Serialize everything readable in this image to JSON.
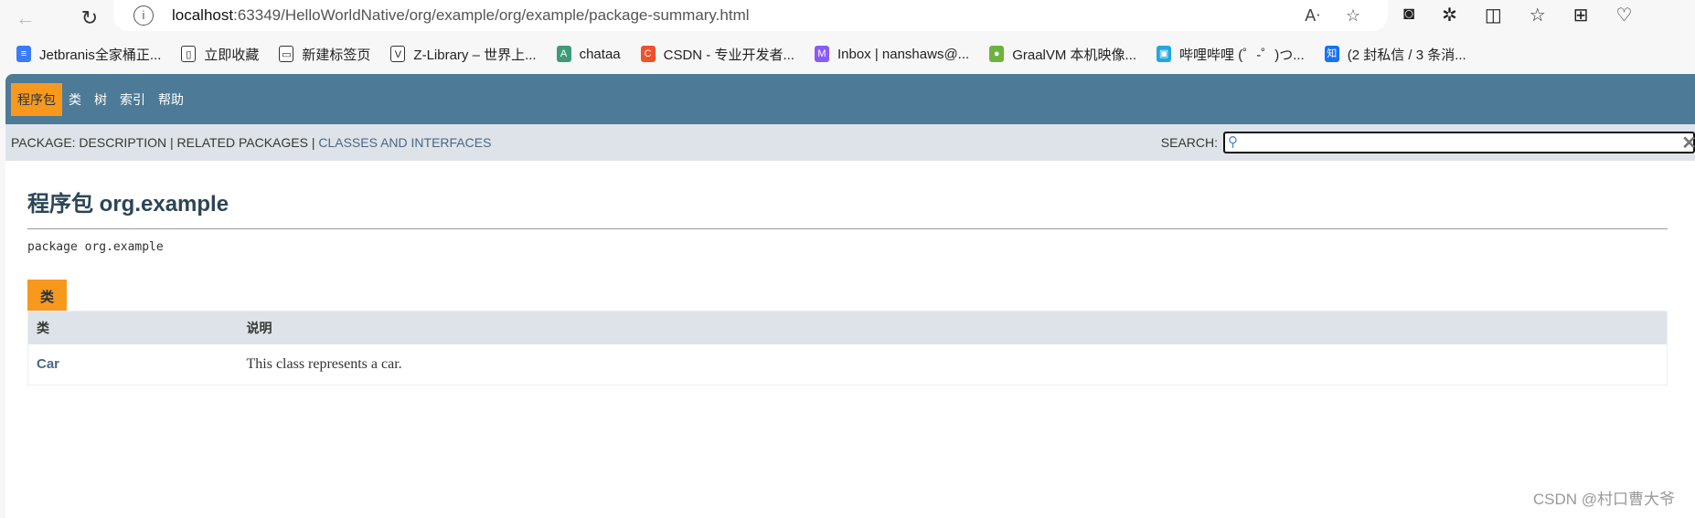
{
  "browser": {
    "url_host": "localhost",
    "url_rest": ":63349/HelloWorldNative/org/example/org/example/package-summary.html",
    "bookmarks": [
      {
        "label": "Jetbranis全家桶正...",
        "color": "#3b7cf6",
        "glyph": "≡"
      },
      {
        "label": "立即收藏",
        "color": "#ffffff",
        "glyph": "▯"
      },
      {
        "label": "新建标签页",
        "color": "#ffffff",
        "glyph": "▭"
      },
      {
        "label": "Z-Library – 世界上...",
        "color": "#ffffff",
        "glyph": "V"
      },
      {
        "label": "chataa",
        "color": "#3d9c77",
        "glyph": "A"
      },
      {
        "label": "CSDN - 专业开发者...",
        "color": "#f0512b",
        "glyph": "C"
      },
      {
        "label": "Inbox | nanshaws@...",
        "color": "#8a5cf6",
        "glyph": "M"
      },
      {
        "label": "GraalVM 本机映像...",
        "color": "#6db33f",
        "glyph": "●"
      },
      {
        "label": "哔哩哔哩 (゜-゜)つ...",
        "color": "#20a8e0",
        "glyph": "▣"
      },
      {
        "label": "(2 封私信 / 3 条消...",
        "color": "#1772f6",
        "glyph": "知"
      }
    ]
  },
  "topnav": [
    "程序包",
    "类",
    "树",
    "索引",
    "帮助"
  ],
  "subnav": {
    "prefix": "PACKAGE: DESCRIPTION | RELATED PACKAGES | ",
    "link": "CLASSES AND INTERFACES",
    "search_label": "SEARCH:"
  },
  "title": "程序包 org.example",
  "package_decl": "package org.example",
  "tab": "类",
  "table": {
    "headers": [
      "类",
      "说明"
    ],
    "rows": [
      {
        "name": "Car",
        "desc": "This class represents a car."
      }
    ]
  },
  "watermark": "CSDN @村口曹大爷"
}
